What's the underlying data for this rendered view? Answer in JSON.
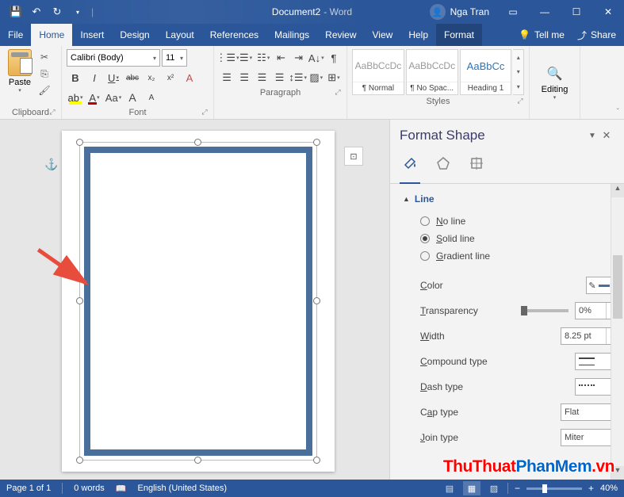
{
  "titlebar": {
    "doc_name": "Document2",
    "app_suffix": " - Word",
    "user": "Nga Tran"
  },
  "menu": {
    "file": "File",
    "home": "Home",
    "insert": "Insert",
    "design": "Design",
    "layout": "Layout",
    "references": "References",
    "mailings": "Mailings",
    "review": "Review",
    "view": "View",
    "help": "Help",
    "format": "Format",
    "tellme": "Tell me",
    "share": "Share"
  },
  "ribbon": {
    "clipboard": {
      "paste": "Paste",
      "label": "Clipboard"
    },
    "font": {
      "name": "Calibri (Body)",
      "size": "11",
      "label": "Font",
      "bold": "B",
      "italic": "I",
      "underline": "U",
      "strike": "abc",
      "sub": "x₂",
      "sup": "x²",
      "clear": "A",
      "hl": "ab",
      "color": "A",
      "case": "Aa",
      "grow": "A",
      "shrink": "A"
    },
    "paragraph": {
      "label": "Paragraph"
    },
    "styles": {
      "label": "Styles",
      "items": [
        {
          "preview": "AaBbCcDc",
          "name": "¶ Normal"
        },
        {
          "preview": "AaBbCcDc",
          "name": "¶ No Spac..."
        },
        {
          "preview": "AaBbCc",
          "name": "Heading 1"
        }
      ]
    },
    "editing": {
      "label": "Editing"
    }
  },
  "pane": {
    "title": "Format Shape",
    "section_line": "Line",
    "no_line": "No line",
    "solid_line": "Solid line",
    "gradient_line": "Gradient line",
    "color": "Color",
    "transparency": "Transparency",
    "transparency_val": "0%",
    "width": "Width",
    "width_val": "8.25 pt",
    "compound": "Compound type",
    "dash": "Dash type",
    "cap": "Cap type",
    "cap_val": "Flat",
    "join": "Join type",
    "join_val": "Miter"
  },
  "status": {
    "page": "Page 1 of 1",
    "words": "0 words",
    "lang": "English (United States)",
    "zoom": "40%"
  },
  "watermark": {
    "part1": "ThuThuat",
    "part2": "PhanMem",
    "part3": ".vn"
  }
}
